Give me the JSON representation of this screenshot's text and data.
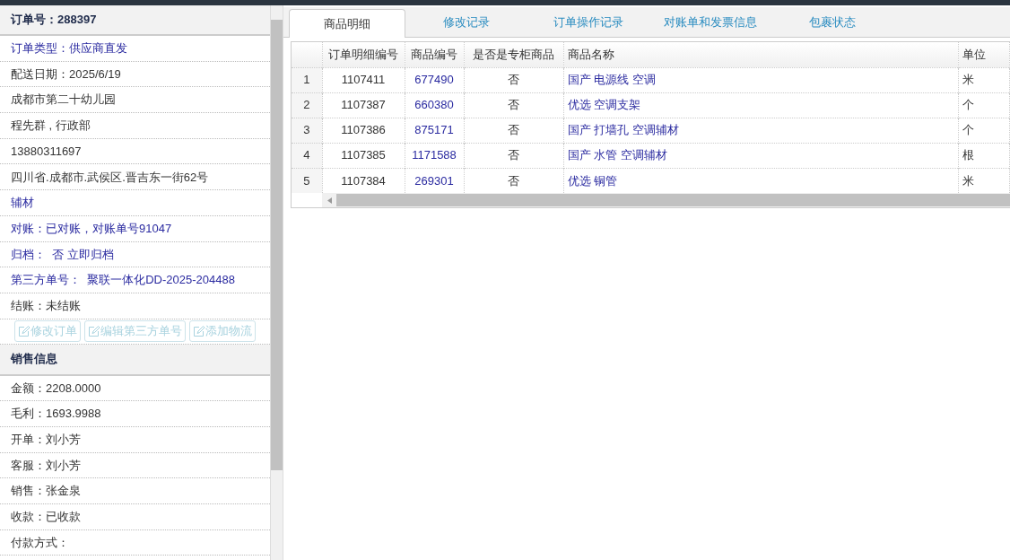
{
  "order_panel": {
    "title": "订单号：288397",
    "fields": [
      {
        "kind": "link",
        "text": "订单类型：供应商直发"
      },
      {
        "kind": "text",
        "text": "配送日期：2025/6/19"
      },
      {
        "kind": "text",
        "text": "成都市第二十幼儿园"
      },
      {
        "kind": "text",
        "text": "程先群 , 行政部"
      },
      {
        "kind": "text",
        "text": "13880311697"
      },
      {
        "kind": "text",
        "text": "四川省.成都市.武侯区.晋吉东一街62号"
      },
      {
        "kind": "link",
        "text": "辅材"
      },
      {
        "kind": "link",
        "text": "对账：已对账，对账单号91047"
      },
      {
        "kind": "link",
        "text": "归档：  否 立即归档"
      },
      {
        "kind": "link",
        "text": "第三方单号：  聚联一体化DD-2025-204488"
      },
      {
        "kind": "text",
        "text": "结账：未结账"
      }
    ],
    "buttons": [
      {
        "label": "修改订单",
        "disabled": true
      },
      {
        "label": "编辑第三方单号",
        "disabled": true
      },
      {
        "label": "添加物流",
        "disabled": true
      }
    ]
  },
  "sales_panel": {
    "title": "销售信息",
    "fields": [
      "金额：2208.0000",
      "毛利：1693.9988",
      "开单：刘小芳",
      "客服：刘小芳",
      "销售：张金泉",
      "收款：已收款",
      "付款方式："
    ]
  },
  "tabs": [
    {
      "label": "商品明细",
      "selected": true
    },
    {
      "label": "修改记录",
      "selected": false
    },
    {
      "label": "订单操作记录",
      "selected": false
    },
    {
      "label": "对账单和发票信息",
      "selected": false
    },
    {
      "label": "包裹状态",
      "selected": false
    }
  ],
  "table": {
    "columns": [
      "订单明细编号",
      "商品编号",
      "是否是专柜商品",
      "商品名称",
      "单位"
    ],
    "rows": [
      {
        "index": "1",
        "detail_no": "1107411",
        "product_no": "677490",
        "counter": "否",
        "name": "国产 电源线 空调",
        "unit": "米"
      },
      {
        "index": "2",
        "detail_no": "1107387",
        "product_no": "660380",
        "counter": "否",
        "name": "优选 空调支架",
        "unit": "个"
      },
      {
        "index": "3",
        "detail_no": "1107386",
        "product_no": "875171",
        "counter": "否",
        "name": "国产 打墙孔 空调辅材",
        "unit": "个"
      },
      {
        "index": "4",
        "detail_no": "1107385",
        "product_no": "1171588",
        "counter": "否",
        "name": "国产 水管 空调辅材",
        "unit": "根"
      },
      {
        "index": "5",
        "detail_no": "1107384",
        "product_no": "269301",
        "counter": "否",
        "name": "优选 铜管",
        "unit": "米"
      }
    ]
  }
}
